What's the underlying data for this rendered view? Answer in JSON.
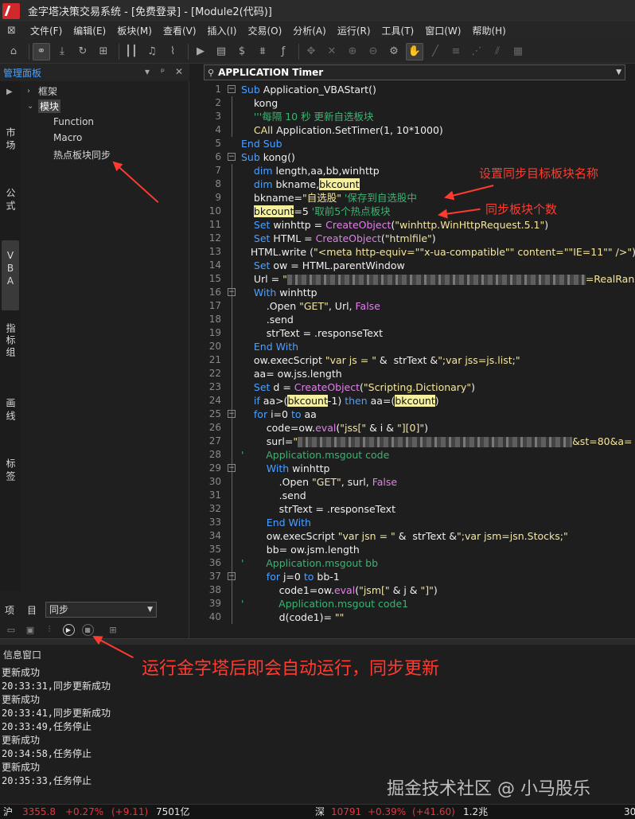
{
  "window": {
    "title": "金字塔决策交易系统 - [免费登录] - [Module2(代码)]"
  },
  "menu": [
    "文件(F)",
    "编辑(E)",
    "板块(M)",
    "查看(V)",
    "插入(I)",
    "交易(O)",
    "分析(A)",
    "运行(R)",
    "工具(T)",
    "窗口(W)",
    "帮助(H)"
  ],
  "toolbar_icons": [
    "home-icon",
    "link-icon",
    "download-icon",
    "refresh-icon",
    "grid-icon",
    "chart-icon",
    "bell-icon",
    "line-chart-icon",
    "play-icon",
    "document-icon",
    "dollar-icon",
    "filter-icon",
    "function-icon",
    "move-icon",
    "cross-icon",
    "zoom-in-icon",
    "zoom-out-icon",
    "gear-icon",
    "hand-icon",
    "pen-icon",
    "channel-icon",
    "fan-icon",
    "parallel-icon",
    "grid-draw-icon"
  ],
  "left_panel": {
    "title": "管理面板",
    "ctrl_dropdown": "▾",
    "ctrl_pin": "ᵖ",
    "ctrl_close": "✕",
    "tabs": [
      {
        "label": "市场"
      },
      {
        "label": "公式"
      },
      {
        "label": "VBA"
      },
      {
        "label": "指标组"
      },
      {
        "label": "画线"
      },
      {
        "label": "标签"
      }
    ],
    "tree": {
      "root1": "框架",
      "root2": "模块",
      "children": [
        "Function",
        "Macro",
        "热点板块同步"
      ]
    },
    "bottom": {
      "label_a": "项",
      "label_b": "目",
      "select_value": "同步"
    }
  },
  "editor": {
    "combo_value": "APPLICATION Timer"
  },
  "info_window": {
    "title": "信息窗口",
    "lines": [
      "更新成功",
      "20:33:31,同步更新成功",
      "更新成功",
      "20:33:41,同步更新成功",
      "20:33:49,任务停止",
      "更新成功",
      "20:34:58,任务停止",
      "更新成功",
      "20:35:33,任务停止"
    ]
  },
  "statusbar": {
    "sh_label": "沪",
    "sh_index": "3355.8",
    "sh_change": "+0.27%",
    "sh_delta": "(+9.11)",
    "sh_volume": "7501亿",
    "sz_label": "深",
    "sz_index": "10791",
    "sz_change": "+0.39%",
    "sz_delta": "(+41.60)",
    "sz_volume": "1.2兆",
    "right_text": "30"
  },
  "annotations": {
    "set_target": "设置同步目标板块名称",
    "block_count": "同步板块个数",
    "auto_run": "运行金字塔后即会自动运行，同步更新"
  },
  "watermark": "掘金技术社区 @ 小马股乐",
  "colors": {
    "keyword": "#4da0ff",
    "comment": "#3cb371",
    "string": "#f5e6a0",
    "function": "#e080e8",
    "highlight": "#f5f0a0",
    "annotation": "#ff3b30",
    "status_red": "#e0393e"
  }
}
